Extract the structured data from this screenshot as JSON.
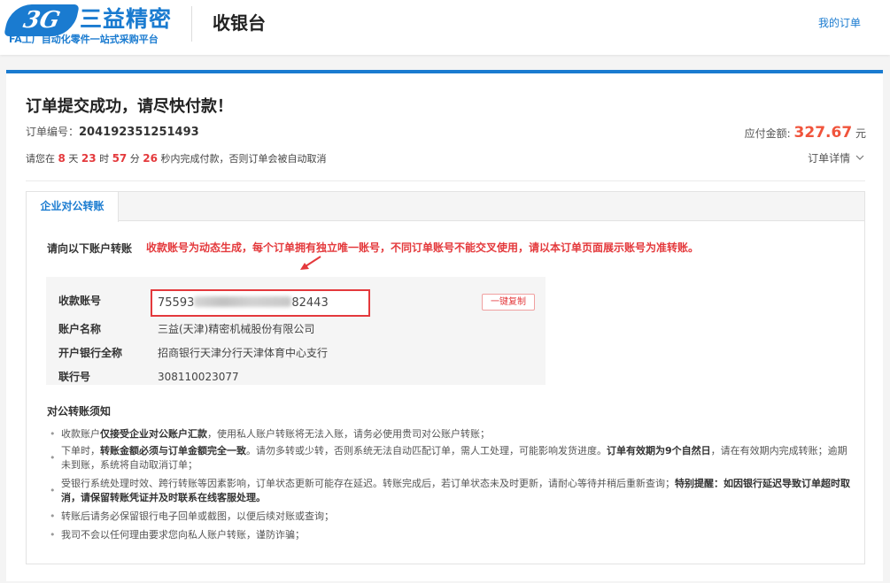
{
  "header": {
    "logo_mark": "3G",
    "logo_name": "三益精密",
    "logo_slogan": "FA工厂自动化零件一站式采购平台",
    "title": "收银台",
    "my_orders": "我的订单"
  },
  "order": {
    "title": "订单提交成功，请尽快付款！",
    "number_label": "订单编号：",
    "number": "204192351251493",
    "amount_label": "应付金额:",
    "amount": "327.67",
    "amount_unit": "元",
    "countdown_prefix": "请您在",
    "days": "8",
    "days_unit": "天",
    "hours": "23",
    "hours_unit": "时",
    "minutes": "57",
    "minutes_unit": "分",
    "seconds": "26",
    "countdown_suffix": "秒内完成付款，否则订单会被自动取消",
    "detail_link": "订单详情"
  },
  "tabs": [
    {
      "label": "企业对公转账",
      "active": true
    }
  ],
  "transfer": {
    "hint_label": "请向以下账户转账",
    "hint_red": "收款账号为动态生成，每个订单拥有独立唯一账号，不同订单账号不能交叉使用，请以本订单页面展示账号为准转账。",
    "rows": {
      "account_no": {
        "label": "收款账号",
        "prefix": "75593",
        "suffix": "82443"
      },
      "account_name": {
        "label": "账户名称",
        "value": "三益(天津)精密机械股份有限公司"
      },
      "bank": {
        "label": "开户银行全称",
        "value": "招商银行天津分行天津体育中心支行"
      },
      "bank_code": {
        "label": "联行号",
        "value": "308110023077"
      }
    },
    "copy_button": "一键复制"
  },
  "notes": {
    "title": "对公转账须知",
    "items": [
      {
        "a": "收款账户",
        "b": "仅接受企业对公账户汇款",
        "c": "，使用私人账户转账将无法入账，请务必使用贵司对公账户转账；"
      },
      {
        "a": "下单时，",
        "b": "转账金额必须与订单金额完全一致",
        "c": "。请勿多转或少转，否则系统无法自动匹配订单，需人工处理，可能影响发货进度。",
        "d": "订单有效期为9个自然日",
        "e": "，请在有效期内完成转账；逾期未到账，系统将自动取消订单；"
      },
      {
        "a": "受银行系统处理时效、跨行转账等因素影响，订单状态更新可能存在延迟。转账完成后，若订单状态未及时更新，请耐心等待并稍后重新查询；",
        "b": "特别提醒：如因银行延迟导致订单超时取消，请保留转账凭证并及时联系在线客服处理。"
      },
      {
        "a": "转账后请务必保留银行电子回单或截图，以便后续对账或查询；"
      },
      {
        "a": "我司不会以任何理由要求您向私人账户转账，谨防诈骗；"
      }
    ]
  },
  "colors": {
    "brand_blue": "#1a7bd0",
    "highlight_red": "#e4393c",
    "amount_orange": "#f0543c"
  },
  "icons": {
    "detail_chevron": "chevron-down-icon",
    "hint_arrow": "arrow-icon"
  }
}
